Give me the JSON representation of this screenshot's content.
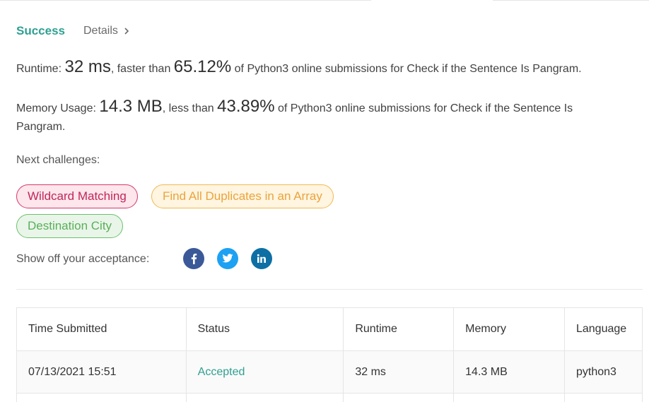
{
  "result": {
    "status": "Success",
    "details_label": "Details"
  },
  "runtime": {
    "label": "Runtime:",
    "value": "32 ms",
    "comparison": ", faster than",
    "percent": "65.12%",
    "suffix": "of Python3 online submissions for Check if the Sentence Is Pangram."
  },
  "memory": {
    "label": "Memory Usage:",
    "value": "14.3 MB",
    "comparison": ", less than",
    "percent": "43.89%",
    "suffix": "of Python3 online submissions for Check if the Sentence Is Pangram."
  },
  "next_challenges": {
    "label": "Next challenges:",
    "items": [
      {
        "label": "Wildcard Matching",
        "color": "#d6386b"
      },
      {
        "label": "Find All Duplicates in an Array",
        "color": "#f0b955"
      },
      {
        "label": "Destination City",
        "color": "#6cc06c"
      }
    ]
  },
  "share": {
    "label": "Show off your acceptance:",
    "icons": [
      "facebook-icon",
      "twitter-icon",
      "linkedin-icon"
    ]
  },
  "submissions": {
    "columns": [
      "Time Submitted",
      "Status",
      "Runtime",
      "Memory",
      "Language"
    ],
    "rows": [
      {
        "time": "07/13/2021 15:51",
        "status": "Accepted",
        "runtime": "32 ms",
        "memory": "14.3 MB",
        "language": "python3"
      }
    ]
  },
  "colors": {
    "accent": "#2fa091",
    "facebook": "#3b5998",
    "twitter": "#1da1f2",
    "linkedin": "#0e6fa4"
  }
}
